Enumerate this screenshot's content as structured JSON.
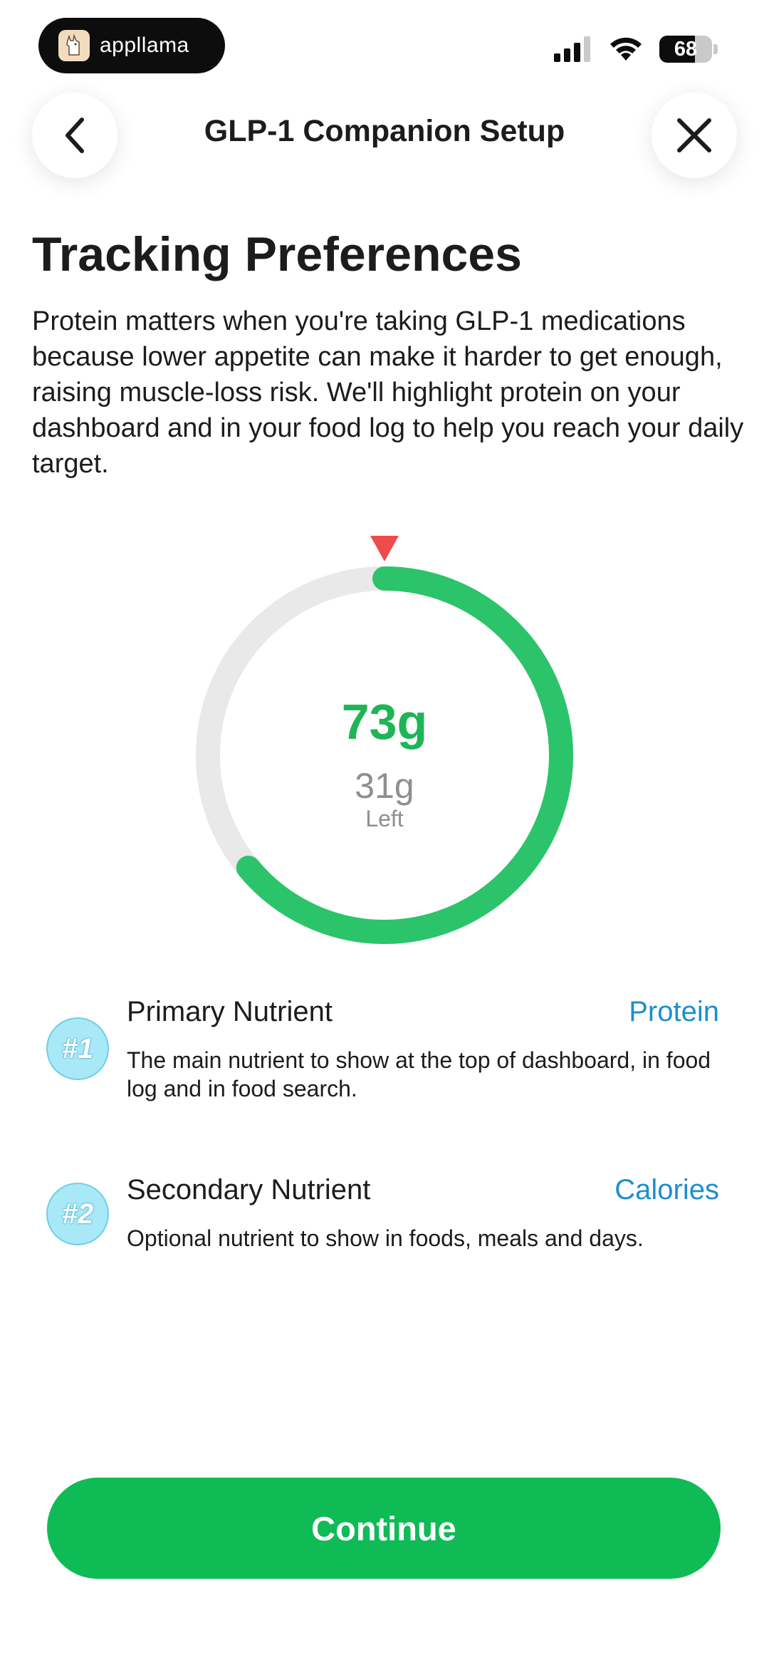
{
  "status_bar": {
    "app_name": "appllama",
    "battery": "68",
    "icons": [
      "signal-icon",
      "wifi-icon",
      "battery-icon"
    ]
  },
  "nav": {
    "title": "GLP-1 Companion Setup",
    "back_icon": "chevron-left-icon",
    "close_icon": "close-icon"
  },
  "heading": "Tracking Preferences",
  "description": "Protein matters when you're taking GLP-1 medications because lower appetite can make it harder to get enough, raising muscle-loss risk. We'll highlight protein on your dashboard and in your food log to help you reach your daily target.",
  "ring": {
    "value": "73g",
    "left_value": "31g",
    "left_label": "Left",
    "progress": 0.64,
    "colors": {
      "track": "#e9e9e9",
      "progress": "#2bc46a",
      "marker": "#ee4b4b"
    }
  },
  "preferences": [
    {
      "badge": "#1",
      "title": "Primary Nutrient",
      "value": "Protein",
      "description": "The main nutrient to show at the top of dashboard, in food log and in food search."
    },
    {
      "badge": "#2",
      "title": "Secondary Nutrient",
      "value": "Calories",
      "description": "Optional nutrient to show in foods, meals and days."
    }
  ],
  "continue_label": "Continue",
  "colors": {
    "accent_green": "#0fbb55",
    "link_blue": "#1b8fcf"
  }
}
